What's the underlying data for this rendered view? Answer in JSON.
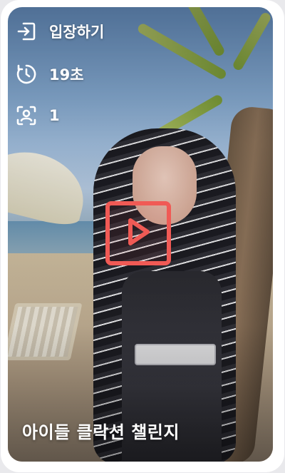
{
  "card": {
    "enter_label": "입장하기",
    "time_label": "19초",
    "participant_count": "1",
    "title": "아이들 클락션 챌린지"
  },
  "icons": {
    "enter": "enter-icon",
    "timer": "timer-icon",
    "participants": "user-scan-icon",
    "play": "play-icon"
  },
  "colors": {
    "play_accent": "#f05a55",
    "overlay_text": "#ffffff",
    "card_background": "#ffffff"
  }
}
